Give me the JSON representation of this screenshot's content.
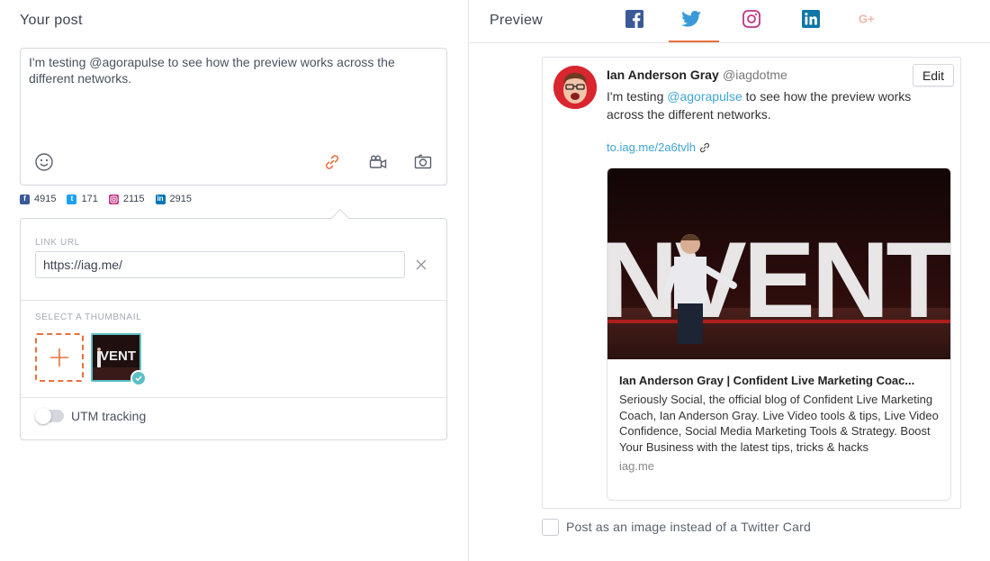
{
  "left": {
    "title": "Your post",
    "composer_text": "I'm testing @agorapulse to see how the preview works across the different networks.",
    "counters": [
      {
        "network": "facebook-icon",
        "value": "4915",
        "color": "#3b5998"
      },
      {
        "network": "twitter-icon",
        "value": "171",
        "color": "#1da1f2"
      },
      {
        "network": "instagram-icon",
        "value": "2115",
        "color": "#c13584"
      },
      {
        "network": "linkedin-icon",
        "value": "2915",
        "color": "#0077b5"
      }
    ],
    "link_panel": {
      "link_label": "LINK URL",
      "url_value": "https://iag.me/",
      "thumbnail_label": "SELECT A THUMBNAIL",
      "utm_label": "UTM tracking",
      "utm_enabled": false
    }
  },
  "right": {
    "title": "Preview",
    "tabs": [
      {
        "name": "facebook",
        "color": "#3b5998",
        "active": false
      },
      {
        "name": "twitter",
        "color": "#1da1f2",
        "active": true
      },
      {
        "name": "instagram",
        "color": "#c13584",
        "active": false
      },
      {
        "name": "linkedin",
        "color": "#0077b5",
        "active": false
      },
      {
        "name": "google-plus",
        "color": "#f1b3a8",
        "active": false
      }
    ],
    "accent": "#e8703d",
    "tweet": {
      "author_name": "Ian Anderson Gray",
      "author_handle": "@iagdotme",
      "edit_label": "Edit",
      "text_before": "I'm testing ",
      "mention": "@agorapulse",
      "text_after": " to see how the preview works across the different networks.",
      "short_link": "to.iag.me/2a6tvlh",
      "card": {
        "title": "Ian Anderson Gray | Confident Live Marketing Coac...",
        "description": "Seriously Social, the official blog of Confident Live Marketing Coach, Ian Anderson Gray. Live Video tools & tips, Live Video Confidence, Social Media Marketing Tools & Strategy. Boost Your Business with the latest tips, tricks & hacks",
        "domain": "iag.me",
        "image_text": "NVENT"
      }
    },
    "post_as_image_label": "Post as an image instead of a Twitter Card",
    "post_as_image_checked": false
  }
}
